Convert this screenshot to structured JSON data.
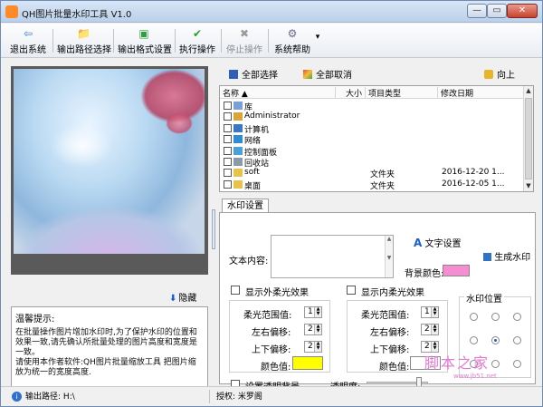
{
  "window": {
    "title": "QH图片批量水印工具 V1.0",
    "min_glyph": "—",
    "max_glyph": "▭",
    "close_glyph": "✕"
  },
  "toolbar": {
    "exit": "退出系统",
    "output_path": "输出路径选择",
    "output_format": "输出格式设置",
    "execute": "执行操作",
    "stop": "停止操作",
    "help": "系统帮助",
    "help_arrow": "▾"
  },
  "left": {
    "hide_label": "隐藏",
    "tips_title": "温馨提示:",
    "tips_body": "在批量操作图片增加水印时,为了保护水印的位置和效果一致,请先确认所批量处理的图片高度和宽度是一致。\n请使用本作者软件:QH图片批量缩放工具 把图片缩放为统一的宽度高度."
  },
  "filebar": {
    "select_all": "全部选择",
    "deselect_all": "全部取消",
    "up": "向上"
  },
  "filelist": {
    "headers": [
      "名称",
      "大小",
      "项目类型",
      "修改日期"
    ],
    "rows": [
      {
        "name": "库",
        "type": "",
        "date": "",
        "icon": "library-icon"
      },
      {
        "name": "Administrator",
        "type": "",
        "date": "",
        "icon": "user-icon"
      },
      {
        "name": "计算机",
        "type": "",
        "date": "",
        "icon": "computer-icon"
      },
      {
        "name": "网络",
        "type": "",
        "date": "",
        "icon": "network-icon"
      },
      {
        "name": "控制面板",
        "type": "",
        "date": "",
        "icon": "control-panel-icon"
      },
      {
        "name": "回收站",
        "type": "",
        "date": "",
        "icon": "recycle-bin-icon"
      },
      {
        "name": "soft",
        "type": "文件夹",
        "date": "2016-12-20 1...",
        "icon": "folder-icon"
      },
      {
        "name": "桌面",
        "type": "文件夹",
        "date": "2016-12-05 1...",
        "icon": "folder-icon"
      }
    ]
  },
  "watermark_tab": {
    "tab_label": "水印设置",
    "text_content_label": "文本内容:",
    "text_content_value": "",
    "text_settings": "文字设置",
    "bg_color_label": "背景颜色:",
    "bg_color": "#f48dd2",
    "generate_watermark": "生成水印",
    "outer_glow": "显示外柔光效果",
    "inner_glow": "显示内柔光效果",
    "watermark_position": "水印位置",
    "outer": {
      "range_label": "柔光范围值:",
      "range_value": "1",
      "left_label": "左右偏移:",
      "left_value": "2",
      "top_label": "上下偏移:",
      "top_value": "2",
      "color_label": "颜色值:",
      "color": "#ffff00"
    },
    "inner": {
      "range_label": "柔光范围值:",
      "range_value": "1",
      "left_label": "左右偏移:",
      "left_value": "2",
      "top_label": "上下偏移:",
      "top_value": "2",
      "color_label": "颜色值:",
      "color": "#ffffff"
    },
    "transparent_bg": "设置透明背景",
    "transparency_label": "透明度:",
    "transparency_level": 0.9,
    "selected_position": "center"
  },
  "watermark_overlay": {
    "main": "脚本之家",
    "sub": "www.jb51.net"
  },
  "status": {
    "output_path_label": "输出路径:",
    "output_path_value": "H:\\",
    "license_label": "授权:",
    "license_value": "米罗阁"
  }
}
